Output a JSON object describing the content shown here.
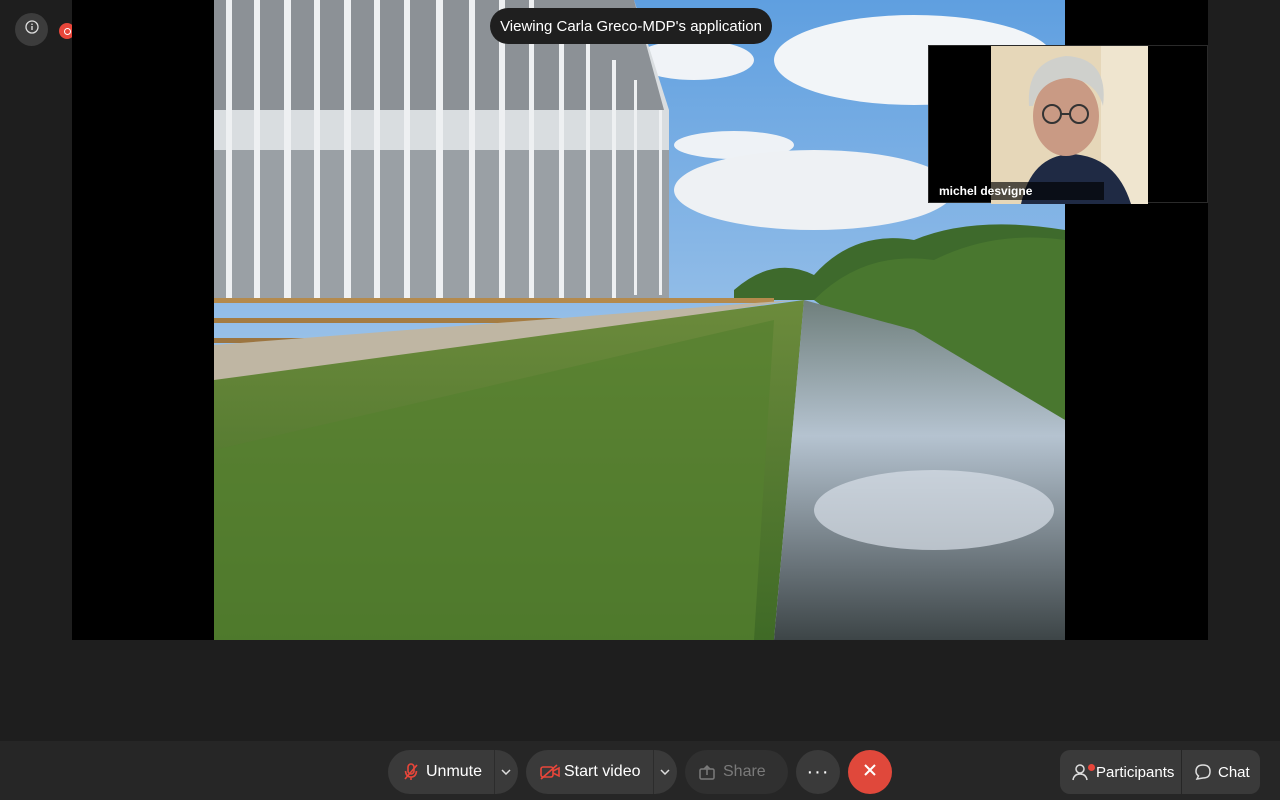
{
  "banner": {
    "text": "Viewing Carla Greco-MDP's application"
  },
  "self_view": {
    "name": "michel desvigne"
  },
  "toolbar": {
    "unmute_label": "Unmute",
    "start_video_label": "Start video",
    "share_label": "Share",
    "more_label": "···",
    "participants_label": "Participants",
    "chat_label": "Chat"
  },
  "colors": {
    "leave": "#e0483b",
    "recording": "#e8463a",
    "background": "#1e1e1e"
  }
}
